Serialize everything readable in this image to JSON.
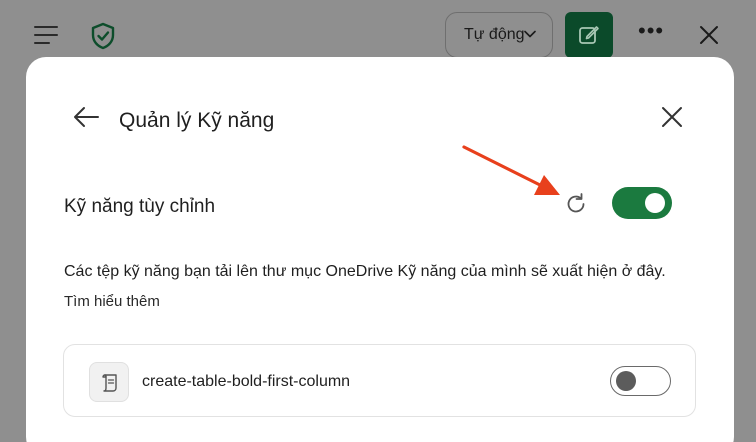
{
  "topbar": {
    "mode_label": "Tự động"
  },
  "modal": {
    "title": "Quản lý Kỹ năng",
    "section_label": "Kỹ năng tùy chỉnh",
    "custom_skills_enabled": true,
    "description": "Các tệp kỹ năng bạn tải lên thư mục OneDrive Kỹ năng của mình sẽ xuất hiện ở đây.",
    "learn_more": "Tìm hiểu thêm",
    "skills": [
      {
        "name": "create-table-bold-first-column",
        "enabled": false
      }
    ]
  },
  "colors": {
    "accent_green": "#1b7a3f",
    "new_chat_bg": "#0b4a2a",
    "annotation_arrow": "#e8401c"
  }
}
